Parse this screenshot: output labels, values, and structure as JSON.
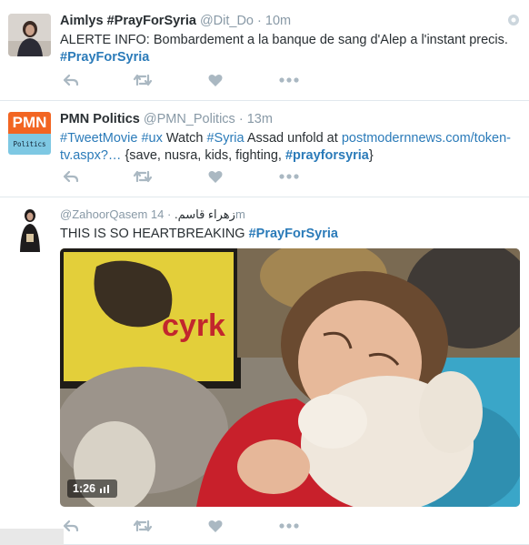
{
  "tweets": [
    {
      "name": "Aimlys #PrayForSyria",
      "handle": "@Dit_Do",
      "time": "10m",
      "text": "ALERTE INFO: Bombardement a la banque de sang d'Alep a l'instant precis.",
      "hashtag": "#PrayForSyria"
    },
    {
      "name": "PMN Politics",
      "handle": "@PMN_Politics",
      "time": "13m",
      "avatar_top": "PMN",
      "avatar_bottom": "Politics",
      "t1": "#TweetMovie",
      "t2": "#ux",
      "t3": " Watch ",
      "t4": "#Syria",
      "t5": " Assad unfold at ",
      "t6": "postmodernnews.com/token-tv.aspx?…",
      "t7": " {save, nusra, kids, fighting, ",
      "t8": "#prayforsyria",
      "t9": "}"
    },
    {
      "handle": "@ZahoorQasem",
      "arabic_name": "زهراء قاسم.",
      "time": "14m",
      "text": "THIS IS SO HEARTBREAKING ",
      "hashtag": "#PrayForSyria",
      "sign_text": "cyrk",
      "video_duration": "1:26"
    }
  ],
  "colors": {
    "link": "#2b7bb9",
    "icon": "#aab8c2",
    "muted": "#8899a6"
  },
  "icons": [
    "reply-icon",
    "retweet-icon",
    "like-icon",
    "more-icon",
    "gear-icon",
    "video-icon"
  ]
}
